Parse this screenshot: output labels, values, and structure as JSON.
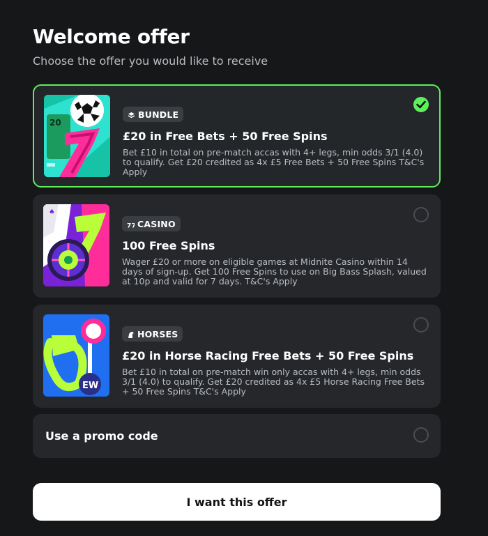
{
  "header": {
    "title": "Welcome offer",
    "subtitle": "Choose the offer you would like to receive"
  },
  "offers": [
    {
      "badge": "BUNDLE",
      "badge_icon": "stack-icon",
      "title": "£20 in Free Bets + 50 Free Spins",
      "description": "Bet £10 in total on pre-match accas with 4+ legs, min odds 3/1 (4.0) to qualify. Get £20 credited as 4x £5 Free Bets + 50 Free Spins T&C's Apply",
      "selected": true,
      "thumb_text": "20"
    },
    {
      "badge": "CASINO",
      "badge_icon": "casino-icon",
      "title": "100 Free Spins",
      "description": "Wager £20 or more on eligible games at Midnite Casino within 14 days of sign-up. Get 100 Free Spins to use on Big Bass Splash, valued at 10p and valid for 7 days. T&C's Apply",
      "selected": false
    },
    {
      "badge": "HORSES",
      "badge_icon": "horse-icon",
      "title": "£20 in Horse Racing Free Bets + 50 Free Spins",
      "description": "Bet £10 in total on pre-match win only accas with 4+ legs, min odds 3/1 (4.0) to qualify. Get £20 credited as 4x £5 Horse Racing Free Bets + 50 Free Spins T&C's Apply",
      "selected": false,
      "thumb_text": "EW"
    }
  ],
  "promo": {
    "label": "Use a promo code",
    "selected": false
  },
  "cta": {
    "label": "I want this offer"
  },
  "colors": {
    "accent": "#5df05a",
    "background": "#161719",
    "card": "#25272a"
  }
}
